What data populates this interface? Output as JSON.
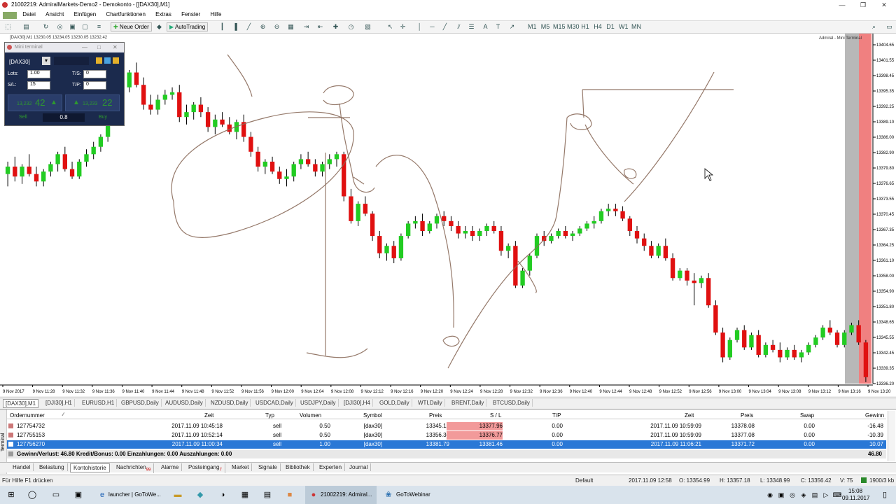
{
  "window": {
    "title": "21002219: AdmiralMarkets-Demo2 - Demokonto - [[DAX30],M1]",
    "minimize": "—",
    "maximize": "❒",
    "close": "✕"
  },
  "menu": [
    "Datei",
    "Ansicht",
    "Einfügen",
    "Chartfunktionen",
    "Extras",
    "Fenster",
    "Hilfe"
  ],
  "toolbar": {
    "new_order": "Neue Order",
    "auto_trading": "AutoTrading",
    "timeframes": [
      "M1",
      "M5",
      "M15",
      "M30",
      "H1",
      "H4",
      "D1",
      "W1",
      "MN"
    ]
  },
  "chart_info": "[DAX30],M1  13230.05 13234.05 13230.05 13232.42",
  "chart_logo": "Admiral - Mini Terminal",
  "mini_terminal": {
    "title": "Mini terminal",
    "symbol": "[DAX30]",
    "lots_label": "Lots:",
    "lots": "1.00",
    "sl_label": "S/L:",
    "sl": "15",
    "ts_label": "T/S:",
    "ts": "0",
    "tp_label": "T/P:",
    "tp": "0",
    "sell_small": "13,232",
    "sell_big": "42",
    "buy_small": "13,233",
    "buy_big": "22",
    "sell_label": "Sell",
    "buy_label": "Buy",
    "spread": "0.8"
  },
  "chart_data": {
    "type": "candlestick",
    "y_range": [
      13336.2,
      13406
    ],
    "y_ticks": [
      "13404.65",
      "13401.55",
      "13398.45",
      "13395.35",
      "13392.25",
      "13389.10",
      "13386.00",
      "13382.90",
      "13379.80",
      "13376.65",
      "13373.55",
      "13370.45",
      "13367.35",
      "13364.25",
      "13361.10",
      "13358.00",
      "13354.90",
      "13351.80",
      "13348.65",
      "13345.55",
      "13342.45",
      "13339.35",
      "13336.20"
    ],
    "x_ticks": [
      "9 Nov 2017",
      "9 Nov 11:28",
      "9 Nov 11:32",
      "9 Nov 11:36",
      "9 Nov 11:40",
      "9 Nov 11:44",
      "9 Nov 11:48",
      "9 Nov 11:52",
      "9 Nov 11:56",
      "9 Nov 12:00",
      "9 Nov 12:04",
      "9 Nov 12:08",
      "9 Nov 12:12",
      "9 Nov 12:16",
      "9 Nov 12:20",
      "9 Nov 12:24",
      "9 Nov 12:28",
      "9 Nov 12:32",
      "9 Nov 12:36",
      "9 Nov 12:40",
      "9 Nov 12:44",
      "9 Nov 12:48",
      "9 Nov 12:52",
      "9 Nov 12:56",
      "9 Nov 13:00",
      "9 Nov 13:04",
      "9 Nov 13:08",
      "9 Nov 13:12",
      "9 Nov 13:16",
      "9 Nov 13:20"
    ],
    "candles": [
      [
        13378.5,
        13381.0,
        13376.0,
        13380.0
      ],
      [
        13380.0,
        13382.0,
        13377.0,
        13378.0
      ],
      [
        13378.0,
        13380.5,
        13376.5,
        13380.0
      ],
      [
        13380.0,
        13382.5,
        13378.0,
        13378.5
      ],
      [
        13378.5,
        13380.0,
        13376.0,
        13377.0
      ],
      [
        13377.0,
        13379.5,
        13376.0,
        13379.0
      ],
      [
        13379.0,
        13381.0,
        13378.0,
        13380.5
      ],
      [
        13380.5,
        13383.0,
        13379.0,
        13382.5
      ],
      [
        13382.5,
        13384.0,
        13379.0,
        13379.5
      ],
      [
        13379.5,
        13381.0,
        13377.5,
        13378.0
      ],
      [
        13378.0,
        13381.5,
        13377.5,
        13381.0
      ],
      [
        13381.0,
        13383.5,
        13380.0,
        13382.5
      ],
      [
        13382.5,
        13385.0,
        13381.5,
        13384.0
      ],
      [
        13384.0,
        13386.5,
        13383.0,
        13386.0
      ],
      [
        13386.0,
        13390.0,
        13385.0,
        13389.0
      ],
      [
        13389.0,
        13394.5,
        13388.5,
        13394.0
      ],
      [
        13394.0,
        13396.5,
        13393.0,
        13396.0
      ],
      [
        13396.0,
        13399.5,
        13395.0,
        13399.0
      ],
      [
        13399.0,
        13401.0,
        13396.0,
        13396.5
      ],
      [
        13396.5,
        13398.0,
        13391.5,
        13392.5
      ],
      [
        13392.5,
        13394.5,
        13390.5,
        13391.5
      ],
      [
        13391.5,
        13394.5,
        13390.5,
        13393.5
      ],
      [
        13393.5,
        13395.5,
        13392.5,
        13394.5
      ],
      [
        13394.5,
        13396.0,
        13393.5,
        13395.0
      ],
      [
        13395.0,
        13396.5,
        13389.0,
        13390.0
      ],
      [
        13390.0,
        13392.5,
        13388.5,
        13391.0
      ],
      [
        13391.0,
        13393.0,
        13389.5,
        13392.5
      ],
      [
        13392.5,
        13394.0,
        13390.0,
        13391.0
      ],
      [
        13391.0,
        13392.0,
        13387.0,
        13388.0
      ],
      [
        13388.0,
        13390.5,
        13386.5,
        13389.5
      ],
      [
        13389.5,
        13391.0,
        13388.0,
        13388.5
      ],
      [
        13388.5,
        13390.0,
        13386.5,
        13387.0
      ],
      [
        13387.0,
        13389.5,
        13385.5,
        13389.0
      ],
      [
        13389.0,
        13390.5,
        13385.0,
        13386.0
      ],
      [
        13386.0,
        13387.0,
        13382.0,
        13383.0
      ],
      [
        13383.0,
        13384.0,
        13379.0,
        13380.0
      ],
      [
        13380.0,
        13381.5,
        13378.5,
        13381.0
      ],
      [
        13381.0,
        13382.0,
        13378.5,
        13379.0
      ],
      [
        13379.0,
        13380.0,
        13376.5,
        13377.5
      ],
      [
        13377.5,
        13379.5,
        13376.0,
        13378.0
      ],
      [
        13378.0,
        13381.0,
        13377.0,
        13380.5
      ],
      [
        13380.5,
        13382.5,
        13379.5,
        13381.5
      ],
      [
        13381.5,
        13383.0,
        13380.0,
        13380.5
      ],
      [
        13380.5,
        13381.5,
        13378.0,
        13379.0
      ],
      [
        13379.0,
        13381.0,
        13378.0,
        13380.5
      ],
      [
        13380.5,
        13382.5,
        13379.5,
        13381.5
      ],
      [
        13381.5,
        13383.0,
        13380.0,
        13382.5
      ],
      [
        13382.5,
        13383.0,
        13373.0,
        13374.0
      ],
      [
        13374.0,
        13375.5,
        13368.5,
        13369.0
      ],
      [
        13369.0,
        13373.0,
        13368.0,
        13372.5
      ],
      [
        13372.5,
        13374.0,
        13370.0,
        13370.5
      ],
      [
        13370.5,
        13371.0,
        13365.0,
        13366.0
      ],
      [
        13366.0,
        13367.0,
        13361.5,
        13362.5
      ],
      [
        13362.5,
        13364.5,
        13361.0,
        13364.0
      ],
      [
        13364.0,
        13365.0,
        13360.5,
        13361.5
      ],
      [
        13361.5,
        13366.5,
        13361.0,
        13366.0
      ],
      [
        13366.0,
        13369.0,
        13365.5,
        13368.5
      ],
      [
        13368.5,
        13370.0,
        13367.5,
        13369.0
      ],
      [
        13369.0,
        13370.5,
        13366.0,
        13367.0
      ],
      [
        13367.0,
        13369.0,
        13366.5,
        13368.5
      ],
      [
        13368.5,
        13370.5,
        13367.5,
        13370.0
      ],
      [
        13370.0,
        13371.0,
        13368.0,
        13369.0
      ],
      [
        13369.0,
        13370.0,
        13367.0,
        13368.0
      ],
      [
        13368.0,
        13369.0,
        13365.5,
        13366.5
      ],
      [
        13366.5,
        13368.0,
        13365.5,
        13367.0
      ],
      [
        13367.0,
        13368.0,
        13365.0,
        13366.0
      ],
      [
        13366.0,
        13367.5,
        13365.0,
        13367.0
      ],
      [
        13367.0,
        13368.5,
        13366.0,
        13368.0
      ],
      [
        13368.0,
        13369.0,
        13366.5,
        13367.0
      ],
      [
        13367.0,
        13368.0,
        13362.0,
        13363.0
      ],
      [
        13363.0,
        13364.5,
        13361.5,
        13364.0
      ],
      [
        13364.0,
        13365.0,
        13355.5,
        13356.0
      ],
      [
        13356.0,
        13359.5,
        13355.5,
        13359.0
      ],
      [
        13359.0,
        13362.5,
        13358.0,
        13362.0
      ],
      [
        13362.0,
        13366.5,
        13361.5,
        13366.0
      ],
      [
        13366.0,
        13367.0,
        13364.0,
        13365.0
      ],
      [
        13365.0,
        13366.5,
        13364.5,
        13366.0
      ],
      [
        13366.0,
        13367.5,
        13365.5,
        13367.0
      ],
      [
        13367.0,
        13368.0,
        13365.5,
        13366.0
      ],
      [
        13366.0,
        13367.0,
        13365.0,
        13366.5
      ],
      [
        13366.5,
        13368.0,
        13366.0,
        13367.5
      ],
      [
        13367.5,
        13369.0,
        13367.0,
        13368.5
      ],
      [
        13368.5,
        13370.0,
        13367.5,
        13369.0
      ],
      [
        13369.0,
        13371.5,
        13368.5,
        13371.0
      ],
      [
        13371.0,
        13372.5,
        13370.0,
        13371.5
      ],
      [
        13371.5,
        13372.5,
        13370.0,
        13371.0
      ],
      [
        13371.0,
        13372.0,
        13369.0,
        13369.5
      ],
      [
        13369.5,
        13370.0,
        13366.0,
        13367.0
      ],
      [
        13367.0,
        13368.0,
        13364.5,
        13365.5
      ],
      [
        13365.5,
        13366.5,
        13363.0,
        13364.0
      ],
      [
        13364.0,
        13365.0,
        13361.5,
        13362.0
      ],
      [
        13362.0,
        13364.5,
        13361.5,
        13364.0
      ],
      [
        13364.0,
        13365.5,
        13361.0,
        13361.5
      ],
      [
        13361.5,
        13362.5,
        13357.0,
        13357.5
      ],
      [
        13357.5,
        13359.5,
        13357.0,
        13359.0
      ],
      [
        13359.0,
        13359.5,
        13356.0,
        13357.0
      ],
      [
        13357.0,
        13358.5,
        13352.0,
        13356.5
      ],
      [
        13356.5,
        13358.0,
        13355.5,
        13357.5
      ],
      [
        13357.5,
        13358.5,
        13351.5,
        13352.0
      ],
      [
        13352.0,
        13353.0,
        13346.0,
        13346.5
      ],
      [
        13346.5,
        13347.5,
        13340.5,
        13341.5
      ],
      [
        13341.5,
        13345.5,
        13341.0,
        13345.0
      ],
      [
        13345.0,
        13347.5,
        13344.5,
        13347.0
      ],
      [
        13347.0,
        13348.0,
        13343.0,
        13343.5
      ],
      [
        13343.5,
        13346.5,
        13343.0,
        13346.0
      ],
      [
        13346.0,
        13347.0,
        13341.5,
        13342.0
      ],
      [
        13342.0,
        13344.5,
        13341.5,
        13344.0
      ],
      [
        13344.0,
        13345.0,
        13342.5,
        13343.0
      ],
      [
        13343.0,
        13344.5,
        13340.5,
        13341.5
      ],
      [
        13341.5,
        13343.5,
        13341.0,
        13343.0
      ],
      [
        13343.0,
        13344.0,
        13341.0,
        13341.5
      ],
      [
        13341.5,
        13343.0,
        13340.5,
        13342.5
      ],
      [
        13342.5,
        13344.5,
        13342.0,
        13344.0
      ],
      [
        13344.0,
        13346.0,
        13343.5,
        13345.5
      ],
      [
        13345.5,
        13348.0,
        13345.0,
        13347.5
      ],
      [
        13347.5,
        13349.0,
        13346.0,
        13346.5
      ],
      [
        13346.5,
        13347.0,
        13343.5,
        13344.0
      ],
      [
        13344.0,
        13347.0,
        13343.5,
        13346.5
      ],
      [
        13346.5,
        13348.5,
        13346.0,
        13348.0
      ],
      [
        13348.0,
        13349.0,
        13344.0,
        13344.5
      ],
      [
        13344.5,
        13345.0,
        13336.5,
        13337.5
      ]
    ]
  },
  "symbol_tabs": [
    "[DAX30],M1",
    "[DJI30],H1",
    "EURUSD,H1",
    "GBPUSD,Daily",
    "AUDUSD,Daily",
    "NZDUSD,Daily",
    "USDCAD,Daily",
    "USDJPY,Daily",
    "[DJI30],H4",
    "GOLD,Daily",
    "WTI,Daily",
    "BRENT,Daily",
    "BTCUSD,Daily"
  ],
  "terminal": {
    "headers": [
      "Ordernummer",
      "Zeit",
      "Typ",
      "Volumen",
      "Symbol",
      "Preis",
      "S / L",
      "T/P",
      "Zeit",
      "Preis",
      "Swap",
      "Gewinn"
    ],
    "rows": [
      [
        "127754732",
        "2017.11.09 10:45:18",
        "sell",
        "0.50",
        "[dax30]",
        "13345.12",
        "13377.96",
        "0.00",
        "2017.11.09 10:59:09",
        "13378.08",
        "0.00",
        "-16.48"
      ],
      [
        "127755153",
        "2017.11.09 10:52:14",
        "sell",
        "0.50",
        "[dax30]",
        "13356.30",
        "13376.77",
        "0.00",
        "2017.11.09 10:59:09",
        "13377.08",
        "0.00",
        "-10.39"
      ],
      [
        "127756270",
        "2017.11.09 11:00:34",
        "sell",
        "1.00",
        "[dax30]",
        "13381.79",
        "13381.46",
        "0.00",
        "2017.11.09 11:06:21",
        "13371.72",
        "0.00",
        "10.07"
      ]
    ],
    "summary": "Gewinn/Verlust: 46.80  Kredit/Bonus: 0.00  Einzahlungen: 0.00  Auszahlungen: 0.00",
    "summary_value": "46.80",
    "side_label": "Terminal"
  },
  "bottom_tabs": [
    "Handel",
    "Belastung",
    "Kontohistorie",
    "Nachrichten",
    "Alarme",
    "Posteingang",
    "Market",
    "Signale",
    "Bibliothek",
    "Experten",
    "Journal"
  ],
  "bottom_tab_badges": {
    "Nachrichten": "99",
    "Posteingang": "7"
  },
  "statusbar": {
    "help": "Für Hilfe F1 drücken",
    "profile": "Default",
    "time": "2017.11.09 12:58",
    "open": "O: 13354.99",
    "high": "H: 13357.18",
    "low": "L: 13348.99",
    "close": "C: 13356.42",
    "volume": "V: 75",
    "traffic": "1900/3 kb"
  },
  "taskbar": {
    "launcher": "launcher | GoToWe...",
    "mt4": "21002219: Admiral...",
    "gotowebinar": "GoToWebinar",
    "clock_time": "15:08",
    "clock_date": "09.11.2017"
  },
  "colors": {
    "bull": "#22cc22",
    "bear": "#e01010",
    "drawing": "#8a6a5a",
    "selected_row": "#2a78d6",
    "sl_highlight": "#f29a9a"
  }
}
